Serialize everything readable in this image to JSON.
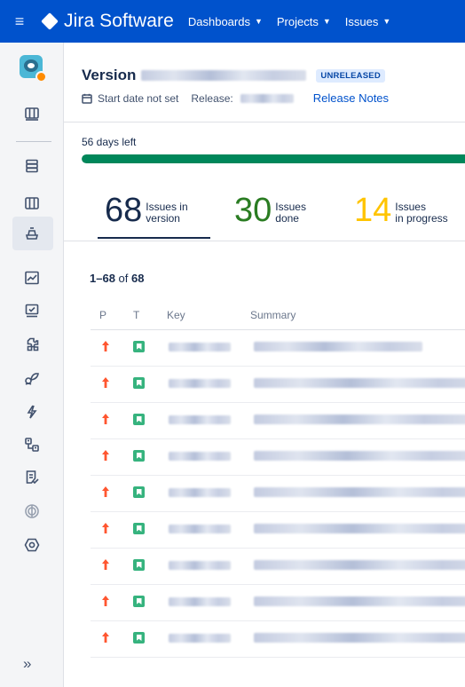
{
  "topbar": {
    "app_name": "Jira Software",
    "nav": [
      "Dashboards",
      "Projects",
      "Issues"
    ],
    "colors": {
      "bar": "#0052cc"
    }
  },
  "sidebar": {
    "icons": [
      "board-icon",
      "backlog-icon",
      "columns-icon",
      "releases-icon",
      "reports-icon",
      "issues-icon",
      "components-icon",
      "code-icon",
      "deployments-icon",
      "repository-icon",
      "pages-icon",
      "add-ons-icon",
      "settings-icon"
    ],
    "expand_label": "»"
  },
  "version": {
    "title_prefix": "Version",
    "status": "UNRELEASED",
    "start_date": "Start date not set",
    "release_label": "Release:",
    "release_notes": "Release Notes",
    "days_left": "56 days left",
    "progress_fraction": 1.0
  },
  "stats": [
    {
      "value": "68",
      "label_line1": "Issues in",
      "label_line2": "version",
      "color": "#172b4d"
    },
    {
      "value": "30",
      "label_line1": "Issues",
      "label_line2": "done",
      "color": "#2a7c22"
    },
    {
      "value": "14",
      "label_line1": "Issues",
      "label_line2": "in progress",
      "color": "#ffc400"
    }
  ],
  "issues": {
    "range": "1–68",
    "of_label": "of",
    "total": "68",
    "columns": {
      "priority": "P",
      "type": "T",
      "key": "Key",
      "summary": "Summary"
    },
    "row_count_visible": 9
  }
}
